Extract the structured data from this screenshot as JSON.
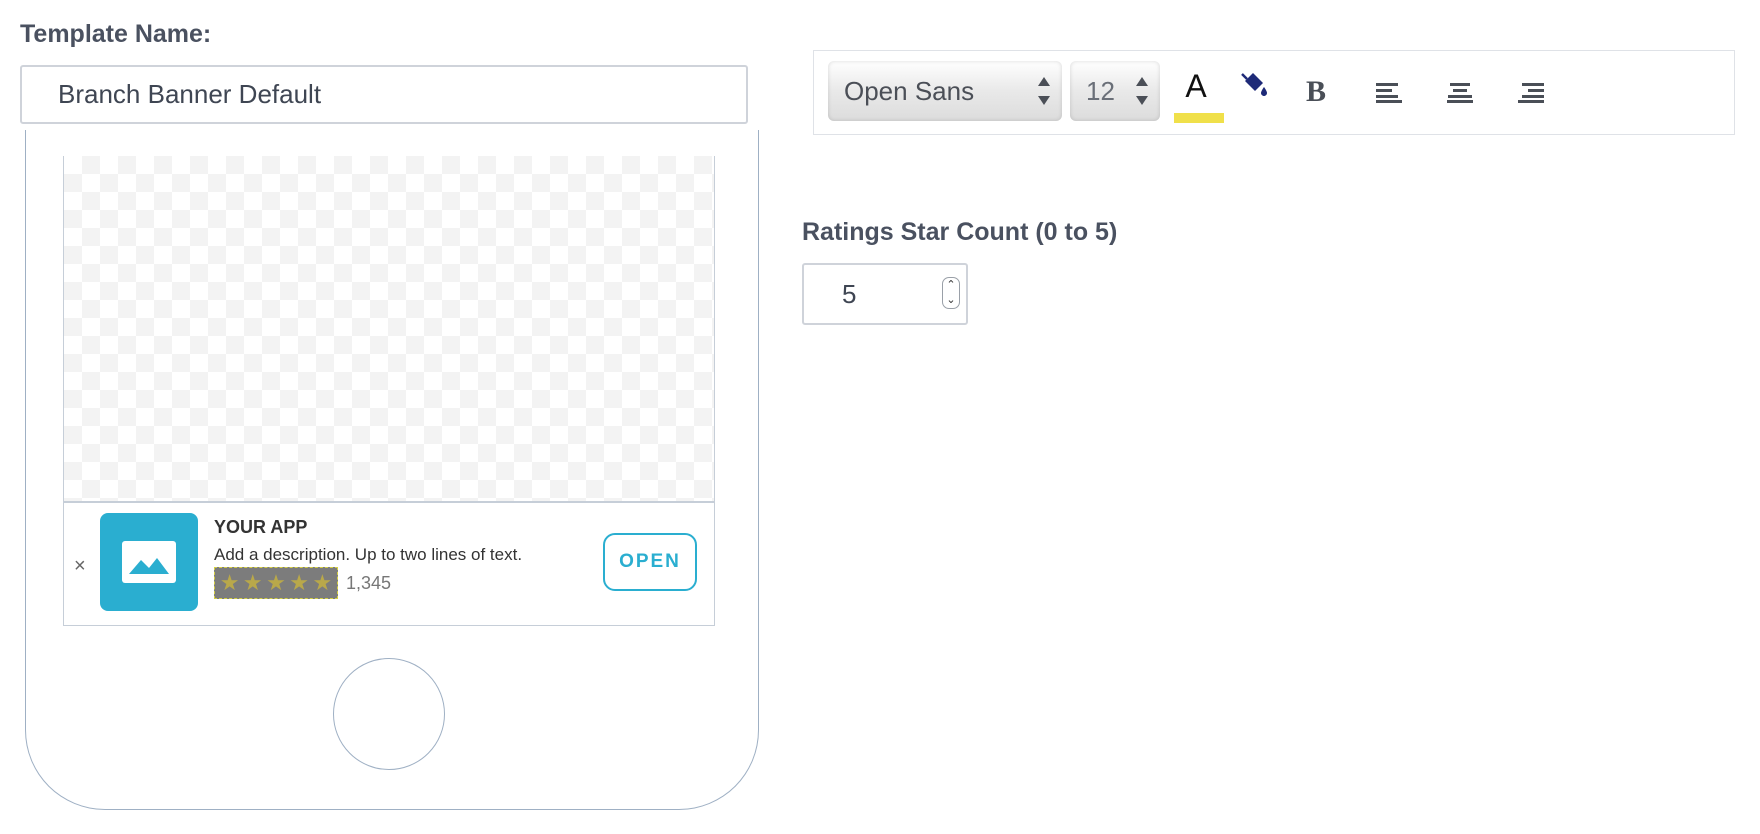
{
  "template": {
    "label": "Template Name:",
    "value": "Branch Banner Default"
  },
  "toolbar": {
    "font": "Open Sans",
    "size": "12",
    "text_color_glyph": "A",
    "text_color": "#f0e04a",
    "fill_color": "#1e2a78",
    "bold_glyph": "B"
  },
  "ratings": {
    "label": "Ratings Star Count (0 to 5)",
    "value": "5"
  },
  "banner": {
    "close": "×",
    "app_name": "YOUR APP",
    "description": "Add a description. Up to two lines of text.",
    "stars": 5,
    "rating_count": "1,345",
    "open_label": "OPEN",
    "accent_color": "#2aaed0"
  }
}
